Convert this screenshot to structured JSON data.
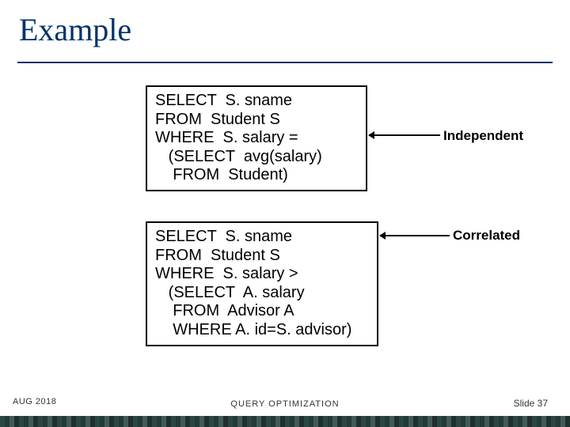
{
  "title": "Example",
  "box1": {
    "lines": [
      "SELECT  S. sname",
      "FROM  Student S",
      "WHERE  S. salary =",
      "   (SELECT  avg(salary)",
      "    FROM  Student)"
    ],
    "annotation": "Independent"
  },
  "box2": {
    "lines": [
      "SELECT  S. sname",
      "FROM  Student S",
      "WHERE  S. salary >",
      "   (SELECT  A. salary",
      "    FROM  Advisor A",
      "    WHERE A. id=S. advisor)"
    ],
    "annotation": "Correlated"
  },
  "footer": {
    "date": "AUG  2018",
    "center": "QUERY  OPTIMIZATION",
    "slide": "Slide 37"
  }
}
